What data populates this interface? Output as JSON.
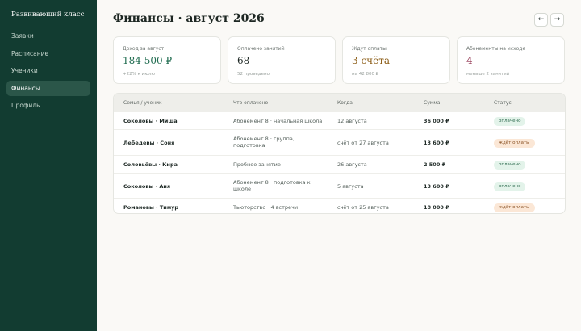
{
  "sidebar": {
    "brand": "Развивающий класс",
    "items": [
      {
        "label": "Заявки",
        "active": false
      },
      {
        "label": "Расписание",
        "active": false
      },
      {
        "label": "Ученики",
        "active": false
      },
      {
        "label": "Финансы",
        "active": true
      },
      {
        "label": "Профиль",
        "active": false
      }
    ]
  },
  "header": {
    "title": "Финансы · август 2026",
    "prev_icon": "arrow-left-icon",
    "next_icon": "arrow-right-icon",
    "prev_glyph": "←",
    "next_glyph": "→"
  },
  "cards": [
    {
      "label": "Доход за август",
      "value": "184 500 ₽",
      "note": "+22% к июлю",
      "color": "#1f6b4f"
    },
    {
      "label": "Оплачено занятий",
      "value": "68",
      "note": "52 проведено",
      "color": "#1d2723"
    },
    {
      "label": "Ждут оплаты",
      "value": "3 счёта",
      "note": "на 42 800 ₽",
      "color": "#8a5a12"
    },
    {
      "label": "Абонементы на исходе",
      "value": "4",
      "note": "меньше 2 занятий",
      "color": "#8e2d4a"
    }
  ],
  "table": {
    "headers": [
      "Семья / ученик",
      "Что оплачено",
      "Когда",
      "Сумма",
      "Статус"
    ],
    "rows": [
      {
        "name": "Соколовы · Миша",
        "what": "Абонемент 8 · начальная школа",
        "when": "12 августа",
        "sum": "36 000 ₽",
        "status": "оплачено",
        "status_kind": "paid"
      },
      {
        "name": "Лебедевы · Соня",
        "what": "Абонемент 8 · группа, подготовка",
        "when": "счёт от 27 августа",
        "sum": "13 600 ₽",
        "status": "ждёт оплаты",
        "status_kind": "wait"
      },
      {
        "name": "Соловьёвы · Кира",
        "what": "Пробное занятие",
        "when": "26 августа",
        "sum": "2 500 ₽",
        "status": "оплачено",
        "status_kind": "paid"
      },
      {
        "name": "Соколовы · Аня",
        "what": "Абонемент 8 · подготовка к школе",
        "when": "5 августа",
        "sum": "13 600 ₽",
        "status": "оплачено",
        "status_kind": "paid"
      },
      {
        "name": "Романовы · Тимур",
        "what": "Тьюторство · 4 встречи",
        "when": "счёт от 25 августа",
        "sum": "18 000 ₽",
        "status": "ждёт оплаты",
        "status_kind": "wait"
      }
    ]
  }
}
